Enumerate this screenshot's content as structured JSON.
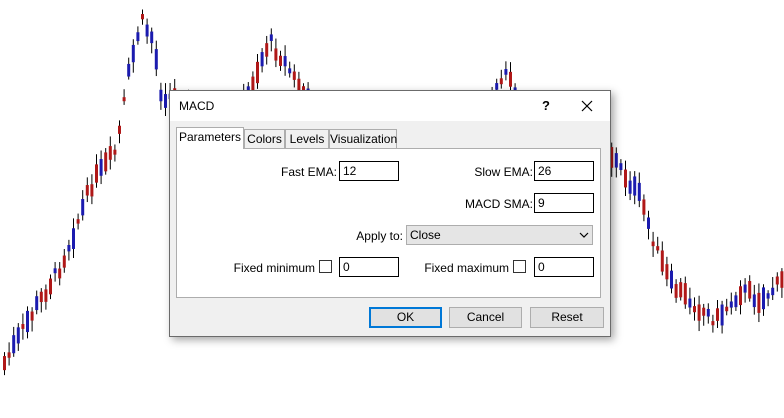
{
  "dialog": {
    "title": "MACD",
    "help_label": "?",
    "tabs": [
      {
        "label": "Parameters",
        "active": true
      },
      {
        "label": "Colors",
        "active": false
      },
      {
        "label": "Levels",
        "active": false
      },
      {
        "label": "Visualization",
        "active": false
      }
    ],
    "params": {
      "fast_ema_label": "Fast EMA:",
      "fast_ema_value": "12",
      "slow_ema_label": "Slow EMA:",
      "slow_ema_value": "26",
      "macd_sma_label": "MACD SMA:",
      "macd_sma_value": "9",
      "apply_to_label": "Apply to:",
      "apply_to_value": "Close",
      "fixed_min_label": "Fixed minimum",
      "fixed_min_checked": false,
      "fixed_min_value": "0",
      "fixed_max_label": "Fixed maximum",
      "fixed_max_checked": false,
      "fixed_max_value": "0"
    },
    "buttons": {
      "ok": "OK",
      "cancel": "Cancel",
      "reset": "Reset"
    }
  },
  "chart": {
    "bull_color": "#1b1baf",
    "bear_color": "#b01818",
    "wick_color": "#000000"
  }
}
